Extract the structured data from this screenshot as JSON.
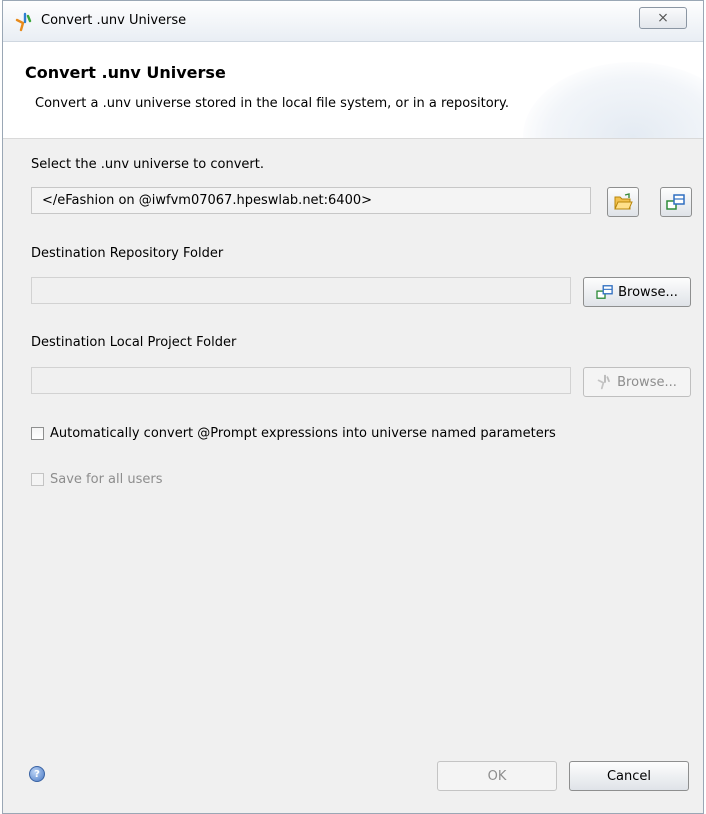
{
  "window": {
    "title": "Convert .unv Universe",
    "close_glyph": "⨯"
  },
  "header": {
    "title": "Convert .unv Universe",
    "description": "Convert a .unv universe stored in the local file system, or in a repository."
  },
  "source": {
    "label": "Select the .unv universe to convert.",
    "value": "</eFashion on  @iwfvm07067.hpeswlab.net:6400>",
    "local_icon": "open-folder-icon",
    "repository_icon": "repository-icon"
  },
  "destination_repository": {
    "label": "Destination Repository Folder",
    "value": "",
    "browse_label": "Browse..."
  },
  "destination_local": {
    "label": "Destination Local Project Folder",
    "value": "",
    "browse_label": "Browse..."
  },
  "options": {
    "convert_prompts": {
      "label": "Automatically convert @Prompt expressions into universe named parameters",
      "checked": false
    },
    "save_all_users": {
      "label": "Save for all users",
      "checked": false,
      "enabled": false
    }
  },
  "footer": {
    "help_glyph": "?",
    "ok_label": "OK",
    "cancel_label": "Cancel"
  },
  "colors": {
    "accent": "#3a63a3",
    "dialog_bg": "#f0f0f0"
  }
}
